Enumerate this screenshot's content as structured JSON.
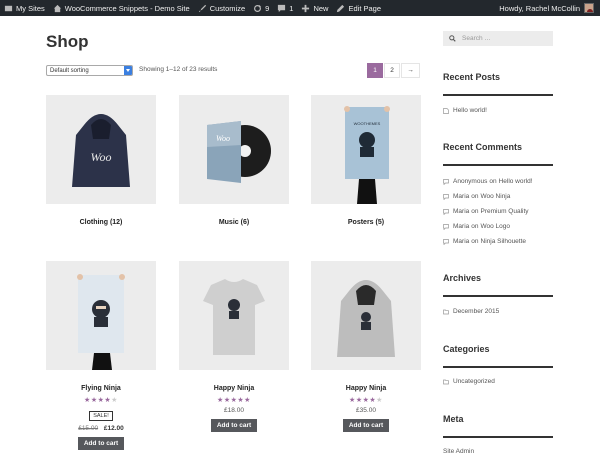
{
  "admin_bar": {
    "my_sites": "My Sites",
    "site_name": "WooCommerce Snippets - Demo Site",
    "customize": "Customize",
    "updates_count": "9",
    "comments_count": "1",
    "new": "New",
    "edit_page": "Edit Page",
    "howdy": "Howdy, Rachel McCollin"
  },
  "page_title": "Shop",
  "sorting": {
    "selected": "Default sorting"
  },
  "result_count": "Showing 1–12 of 23 results",
  "pagination": {
    "pages": [
      "1",
      "2"
    ],
    "next": "→",
    "current": "1"
  },
  "categories": [
    {
      "name": "Clothing",
      "count": "(12)"
    },
    {
      "name": "Music",
      "count": "(6)"
    },
    {
      "name": "Posters",
      "count": "(5)"
    }
  ],
  "products": [
    {
      "title": "Flying Ninja",
      "rating": 4,
      "sale_label": "SALE!",
      "price_old": "£15.00",
      "price": "£12.00",
      "button": "Add to cart"
    },
    {
      "title": "Happy Ninja",
      "rating": 5,
      "price": "£18.00",
      "button": "Add to cart"
    },
    {
      "title": "Happy Ninja",
      "rating": 4,
      "price": "£35.00",
      "button": "Add to cart"
    }
  ],
  "sidebar": {
    "search_placeholder": "Search …",
    "recent_posts": {
      "title": "Recent Posts",
      "items": [
        "Hello world!"
      ]
    },
    "recent_comments": {
      "title": "Recent Comments",
      "on_word": "on",
      "items": [
        {
          "author": "Anonymous",
          "post": "Hello world!"
        },
        {
          "author": "Maria",
          "post": "Woo Ninja"
        },
        {
          "author": "Maria",
          "post": "Premium Quality"
        },
        {
          "author": "Maria",
          "post": "Woo Logo"
        },
        {
          "author": "Maria",
          "post": "Ninja Silhouette"
        }
      ]
    },
    "archives": {
      "title": "Archives",
      "items": [
        "December 2015"
      ]
    },
    "categories": {
      "title": "Categories",
      "items": [
        "Uncategorized"
      ]
    },
    "meta": {
      "title": "Meta",
      "items": [
        "Site Admin"
      ]
    }
  },
  "colors": {
    "accent": "#9a6a9e",
    "button": "#56585c",
    "admin_bar": "#23282d"
  }
}
